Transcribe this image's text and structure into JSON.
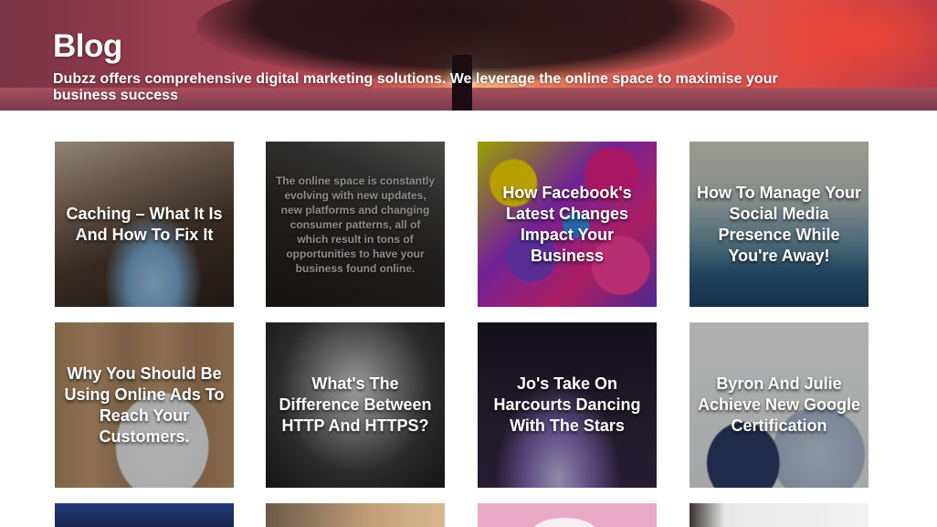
{
  "hero": {
    "title": "Blog",
    "subtitle": "Dubzz offers comprehensive digital marketing solutions. We leverage the online space to maximise your business success"
  },
  "posts": [
    {
      "title": "Caching – What It Is And How To Fix It"
    },
    {
      "excerpt": "The online space is constantly evolving with new updates, new platforms and changing consumer patterns, all of which result in tons of opportunities to have your business found online."
    },
    {
      "title": "How Facebook's Latest Changes Impact Your Business"
    },
    {
      "title": "How To Manage Your Social Media Presence While You're Away!"
    },
    {
      "title": "Why You Should Be Using Online Ads To Reach Your Customers."
    },
    {
      "title": "What's The Difference Between HTTP And HTTPS?"
    },
    {
      "title": "Jo's Take On Harcourts Dancing With The Stars"
    },
    {
      "title": "Byron And Julie Achieve New Google Certification"
    }
  ]
}
